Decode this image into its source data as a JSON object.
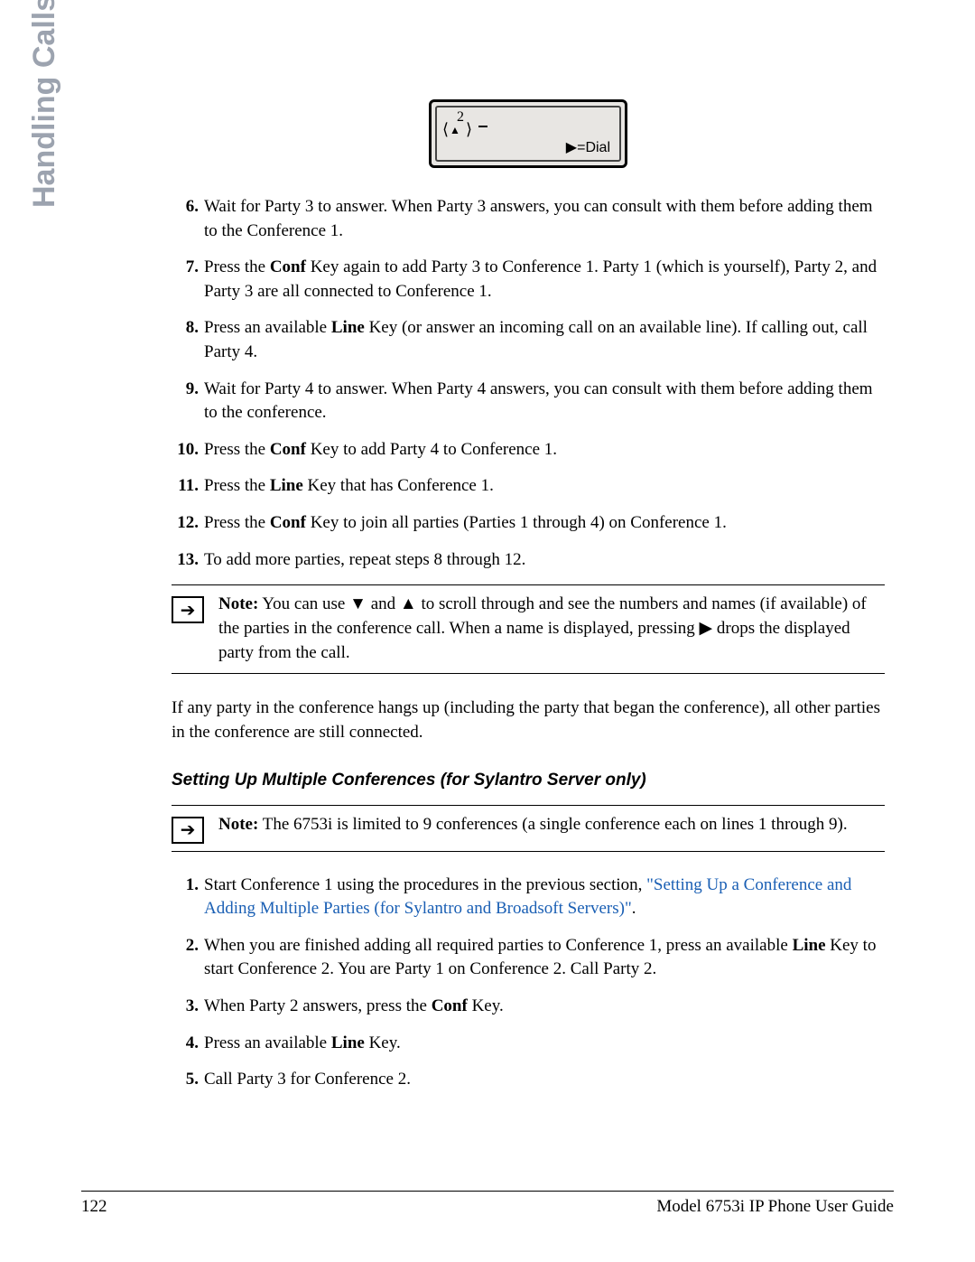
{
  "sidebar": {
    "label": "Handling Calls"
  },
  "screen": {
    "num": "2",
    "dial": "=Dial"
  },
  "steps1": [
    {
      "n": "6.",
      "pre": "Wait for Party 3 to answer. When Party 3 answers, you can consult with them before adding them to the Conference 1."
    },
    {
      "n": "7.",
      "pre": "Press the ",
      "b1": "Conf",
      "mid": " Key again to add Party 3 to Conference 1. Party 1 (which is yourself), Party 2, and Party 3 are all connected to Conference 1."
    },
    {
      "n": "8.",
      "pre": "Press an available ",
      "b1": "Line",
      "mid": " Key (or answer an incoming call on an available line). If calling out, call Party 4."
    },
    {
      "n": "9.",
      "pre": "Wait for Party 4 to answer. When Party 4 answers, you can consult with them before adding them to the conference."
    },
    {
      "n": "10.",
      "pre": "Press the ",
      "b1": "Conf",
      "mid": " Key to add Party 4 to Conference 1."
    },
    {
      "n": "11.",
      "pre": "Press the ",
      "b1": "Line",
      "mid": " Key that has Conference 1."
    },
    {
      "n": "12.",
      "pre": "Press the ",
      "b1": "Conf",
      "mid": " Key to join all parties (Parties 1 through 4) on Conference 1."
    },
    {
      "n": "13.",
      "pre": "To add more parties, repeat steps 8 through 12."
    }
  ],
  "note1": {
    "label": "Note:",
    "t1": " You can use ",
    "t2": " and ",
    "t3": " to scroll through and see the numbers and names (if available) of the parties in the conference call. When a name is displayed, pressing ",
    "t4": " drops the displayed party from the call."
  },
  "para1": "If any party in the conference hangs up (including the party that began the conference), all other parties in the conference are still connected.",
  "subhead": "Setting Up Multiple Conferences (for Sylantro Server only)",
  "note2": {
    "label": "Note:",
    "text": " The 6753i is limited to 9 conferences (a single conference each on lines 1 through 9)."
  },
  "steps2": [
    {
      "n": "1.",
      "pre": "Start Conference 1 using the procedures in the previous section, ",
      "link": "\"Setting Up a Conference and Adding Multiple Parties (for Sylantro and Broadsoft Servers)\"",
      "post": "."
    },
    {
      "n": "2.",
      "pre": "When you are finished adding all required parties to Conference 1, press an available ",
      "b1": "Line",
      "mid": " Key to start Conference 2. You are Party 1 on Conference 2. Call Party 2."
    },
    {
      "n": "3.",
      "pre": "When Party 2 answers, press the ",
      "b1": "Conf",
      "mid": " Key."
    },
    {
      "n": "4.",
      "pre": "Press an available ",
      "b1": "Line",
      "mid": " Key."
    },
    {
      "n": "5.",
      "pre": "Call Party 3 for Conference 2."
    }
  ],
  "footer": {
    "page": "122",
    "title": "Model 6753i IP Phone User Guide"
  }
}
